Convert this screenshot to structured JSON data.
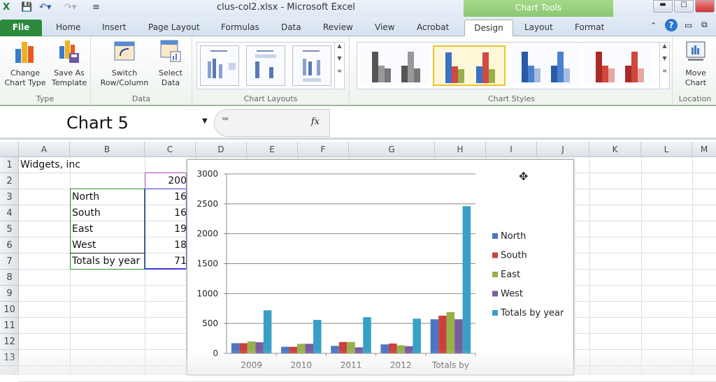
{
  "window": {
    "title": "clus-col2.xlsx  -  Microsoft Excel",
    "contextual_header": "Chart Tools",
    "qat": [
      "excel-logo-icon",
      "save-icon",
      "undo-icon",
      "redo-icon",
      "customize-qat-icon"
    ]
  },
  "tabs": [
    {
      "label": "File"
    },
    {
      "label": "Home"
    },
    {
      "label": "Insert"
    },
    {
      "label": "Page Layout"
    },
    {
      "label": "Formulas"
    },
    {
      "label": "Data"
    },
    {
      "label": "Review"
    },
    {
      "label": "View"
    },
    {
      "label": "Acrobat"
    },
    {
      "label": "Design",
      "active": true
    },
    {
      "label": "Layout"
    },
    {
      "label": "Format"
    }
  ],
  "ribbon": {
    "groups": {
      "type": {
        "label": "Type",
        "buttons": [
          {
            "label": "Change\nChart Type"
          },
          {
            "label": "Save As\nTemplate"
          }
        ]
      },
      "data": {
        "label": "Data",
        "buttons": [
          {
            "label": "Switch\nRow/Column"
          },
          {
            "label": "Select\nData"
          }
        ]
      },
      "layouts": {
        "label": "Chart Layouts"
      },
      "styles": {
        "label": "Chart Styles",
        "selected_index": 1
      },
      "location": {
        "label": "Location",
        "buttons": [
          {
            "label": "Move\nChart"
          }
        ]
      }
    }
  },
  "formula_bar": {
    "name_box": "Chart 5",
    "fx": "fx",
    "formula": ""
  },
  "columns": [
    "A",
    "B",
    "C",
    "D",
    "E",
    "F",
    "G",
    "H",
    "I",
    "J",
    "K",
    "L"
  ],
  "rows": [
    "1",
    "2",
    "3",
    "4",
    "5",
    "6",
    "7",
    "8",
    "9",
    "10",
    "11",
    "12",
    "13"
  ],
  "cells": {
    "A1": "Widgets, inc",
    "C2": "200",
    "B3": "North",
    "C3": "16",
    "B4": "South",
    "C4": "16",
    "B5": "East",
    "C5": "19",
    "B6": "West",
    "C6": "18",
    "B7": "Totals by year",
    "C7": "71"
  },
  "chart_data": {
    "type": "bar",
    "categories": [
      "2009",
      "2010",
      "2011",
      "2012",
      "Totals by"
    ],
    "series": [
      {
        "name": "North",
        "color": "#4a76c4",
        "values": [
          170,
          110,
          125,
          150,
          570
        ]
      },
      {
        "name": "South",
        "color": "#c8423d",
        "values": [
          170,
          110,
          190,
          165,
          630
        ]
      },
      {
        "name": "East",
        "color": "#98b04a",
        "values": [
          200,
          160,
          190,
          135,
          690
        ]
      },
      {
        "name": "West",
        "color": "#7a5aa0",
        "values": [
          185,
          160,
          100,
          120,
          570
        ]
      },
      {
        "name": "Totals by year",
        "color": "#37a0c4",
        "values": [
          720,
          560,
          605,
          580,
          2460
        ]
      }
    ],
    "yticks": [
      "0",
      "500",
      "1000",
      "1500",
      "2000",
      "2500",
      "3000"
    ],
    "ylim": [
      0,
      3000
    ],
    "grid": true,
    "legend": "right",
    "title": "",
    "xlabel": "",
    "ylabel": ""
  }
}
